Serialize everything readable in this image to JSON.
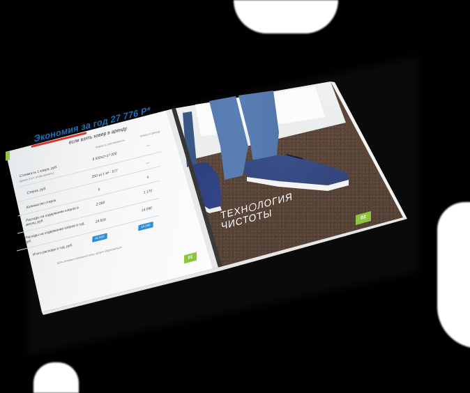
{
  "brochure": {
    "left_page": {
      "title": "Экономия за год 27 776 Р*",
      "subtitle": "если взять ковер в аренду",
      "column_headers": [
        "Ковры в собственность",
        "Ковры в аренду"
      ],
      "rows": [
        {
          "label": "Стоимость 1 ковра, руб.",
          "sublabel": "(нужно 2 шт. чтобы менять)",
          "own": "8 500х2=17 000",
          "rent": "—"
        },
        {
          "label": "Стирка, руб.",
          "own": "250 за 1 м² - 577",
          "rent": "—"
        },
        {
          "label": "Количество стирок",
          "own": "6",
          "rent": "4"
        },
        {
          "label": "Расходы на содержание ковров в месяц, руб.",
          "own": "2 068",
          "rent": "1 170"
        },
        {
          "label": "Расходы на содержание ковров в год, руб.",
          "own": "24 816",
          "rent": "14 040"
        },
        {
          "label": "Итого расходы в год, руб.",
          "own": "41 816",
          "rent": "14 040"
        }
      ],
      "footnote": "*Для сетевых компаний цены могут обсуждаться",
      "page_number": "01"
    },
    "right_page": {
      "brand_line1": "ТЕХН",
      "brand_line1_rest": "ЛОГИЯ",
      "brand_line2": "ЧИСТОТЫ",
      "page_number": "02"
    }
  },
  "colors": {
    "accent_blue": "#1f6fb8",
    "accent_red": "#d9342b",
    "badge_blue": "#2f8fd6",
    "page_green": "#8cc63f",
    "carpet_brown": "#5a4538"
  }
}
